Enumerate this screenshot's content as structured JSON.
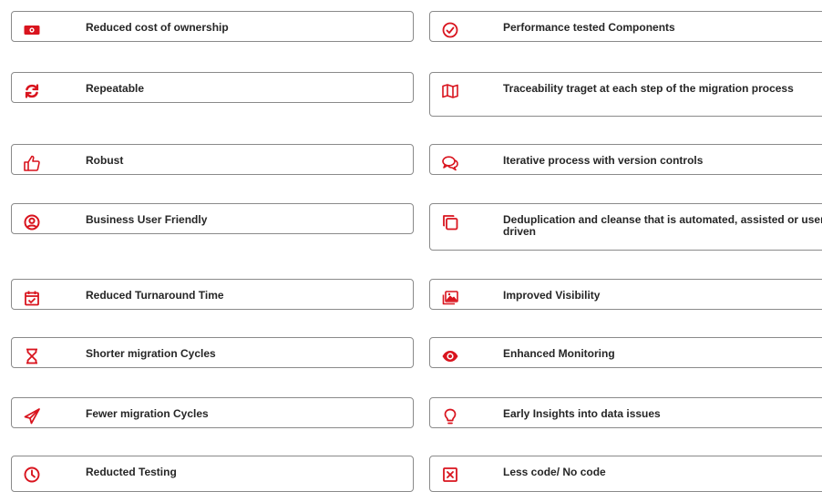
{
  "accent_color": "#d9141e",
  "features_left": [
    {
      "icon": "money-icon",
      "label": "Reduced cost of ownership"
    },
    {
      "icon": "refresh-icon",
      "label": "Repeatable"
    },
    {
      "icon": "thumbs-up-icon",
      "label": "Robust"
    },
    {
      "icon": "user-circle-icon",
      "label": "Business User Friendly"
    },
    {
      "icon": "calendar-check-icon",
      "label": "Reduced Turnaround Time"
    },
    {
      "icon": "hourglass-icon",
      "label": "Shorter migration Cycles"
    },
    {
      "icon": "paper-plane-icon",
      "label": "Fewer migration Cycles"
    },
    {
      "icon": "clock-icon",
      "label": "Reducted Testing"
    }
  ],
  "features_right": [
    {
      "icon": "check-circle-icon",
      "label": "Performance tested Components"
    },
    {
      "icon": "map-icon",
      "label": "Traceability traget at each step of the migration process"
    },
    {
      "icon": "comments-icon",
      "label": "Iterative process with version controls"
    },
    {
      "icon": "copy-icon",
      "label": "Deduplication and cleanse that is automated, assisted or user driven"
    },
    {
      "icon": "images-icon",
      "label": "Improved Visibility"
    },
    {
      "icon": "eye-icon",
      "label": "Enhanced Monitoring"
    },
    {
      "icon": "lightbulb-icon",
      "label": "Early Insights into data issues"
    },
    {
      "icon": "close-box-icon",
      "label": "Less code/ No code"
    }
  ]
}
